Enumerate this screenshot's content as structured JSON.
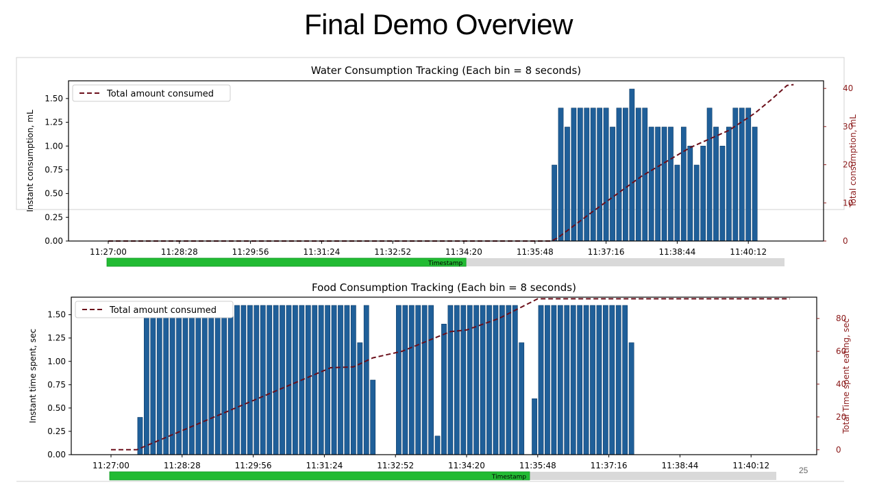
{
  "slide": {
    "title": "Final Demo Overview",
    "page_number": "25"
  },
  "colors": {
    "bar": "#1f5f99",
    "bar_edge": "#0d3b66",
    "total_line": "#6b0f1a",
    "right_axis": "#8b1a1a",
    "scroll_thumb": "#22bb33",
    "scroll_track": "#d9d9d9"
  },
  "chart_data": [
    {
      "type": "bar",
      "title": "Water Consumption Tracking (Each bin = 8 seconds)",
      "xlabel": "Timestamp",
      "ylabel": "Instant consumption, mL",
      "ylabel_right": "Total consumption, mL",
      "x_ticks": [
        "11:27:00",
        "11:28:28",
        "11:29:56",
        "11:31:24",
        "11:32:52",
        "11:34:20",
        "11:35:48",
        "11:37:16",
        "11:38:44",
        "11:40:12"
      ],
      "ylim": [
        0,
        1.6
      ],
      "yticks": [
        "0.00",
        "0.25",
        "0.50",
        "0.75",
        "1.00",
        "1.25",
        "1.50"
      ],
      "ylim_right": [
        0,
        42
      ],
      "yticks_right": [
        "0",
        "10",
        "20",
        "30",
        "40"
      ],
      "bin_seconds": 8,
      "legend": {
        "entry": "Total amount consumed",
        "placement": "top-left"
      },
      "series": [
        {
          "name": "Instant consumption",
          "start": "11:36:08",
          "values": [
            0.8,
            1.4,
            1.2,
            1.4,
            1.4,
            1.4,
            1.4,
            1.4,
            1.4,
            1.2,
            1.4,
            1.4,
            1.6,
            1.4,
            1.4,
            1.2,
            1.2,
            1.2,
            1.2,
            0.8,
            1.2,
            1.0,
            0.8,
            1.0,
            1.4,
            1.2,
            1.0,
            1.2,
            1.4,
            1.4,
            1.4,
            1.2
          ]
        },
        {
          "name": "Total amount consumed",
          "points": [
            [
              "11:27:00",
              0
            ],
            [
              "11:36:08",
              0
            ],
            [
              "11:36:16",
              0.8
            ],
            [
              "11:37:00",
              7.8
            ],
            [
              "11:38:00",
              17
            ],
            [
              "11:39:00",
              24.5
            ],
            [
              "11:39:48",
              29
            ],
            [
              "11:40:20",
              33.5
            ],
            [
              "11:40:40",
              37
            ],
            [
              "11:41:00",
              40.8
            ],
            [
              "11:41:08",
              41
            ]
          ]
        }
      ],
      "scrollbar": {
        "visible_fraction": 0.53
      }
    },
    {
      "type": "bar",
      "title": "Food Consumption Tracking (Each bin = 8 seconds)",
      "xlabel": "Timestamp",
      "ylabel": "Instant time spent, sec",
      "ylabel_right": "Total Time spent eating, sec",
      "x_ticks": [
        "11:27:00",
        "11:28:28",
        "11:29:56",
        "11:31:24",
        "11:32:52",
        "11:34:20",
        "11:35:48",
        "11:37:16",
        "11:38:44",
        "11:40:12"
      ],
      "ylim": [
        0,
        1.6
      ],
      "yticks": [
        "0.00",
        "0.25",
        "0.50",
        "0.75",
        "1.00",
        "1.25",
        "1.50"
      ],
      "ylim_right": [
        -3,
        93
      ],
      "yticks_right": [
        "0",
        "20",
        "40",
        "60",
        "80"
      ],
      "bin_seconds": 8,
      "legend": {
        "entry": "Total amount consumed",
        "placement": "top-left"
      },
      "series": [
        {
          "name": "Instant time spent",
          "start": "11:27:32",
          "values": [
            0.4,
            1.6,
            1.6,
            1.6,
            1.6,
            1.6,
            1.6,
            1.6,
            1.6,
            1.6,
            1.6,
            1.6,
            1.6,
            1.6,
            1.6,
            1.6,
            1.6,
            1.6,
            1.6,
            1.6,
            1.6,
            1.6,
            1.6,
            1.6,
            1.6,
            1.6,
            1.6,
            1.6,
            1.6,
            1.6,
            1.6,
            1.6,
            1.6,
            1.6,
            1.2,
            1.6,
            0.8,
            0,
            0,
            0,
            1.6,
            1.6,
            1.6,
            1.6,
            1.6,
            1.6,
            0.2,
            1.4,
            1.6,
            1.6,
            1.6,
            1.6,
            1.6,
            1.6,
            1.6,
            1.6,
            1.6,
            1.6,
            1.6,
            1.2,
            0,
            0.6,
            1.6,
            1.6,
            1.6,
            1.6,
            1.6,
            1.6,
            1.6,
            1.6,
            1.6,
            1.6,
            1.6,
            1.6,
            1.6,
            1.6,
            1.2
          ]
        },
        {
          "name": "Total amount consumed",
          "points": [
            [
              "11:27:00",
              0
            ],
            [
              "11:27:32",
              0
            ],
            [
              "11:31:32",
              50
            ],
            [
              "11:32:00",
              50.5
            ],
            [
              "11:32:24",
              56
            ],
            [
              "11:33:00",
              60
            ],
            [
              "11:34:00",
              72
            ],
            [
              "11:34:20",
              73
            ],
            [
              "11:35:00",
              80
            ],
            [
              "11:35:40",
              90
            ],
            [
              "11:35:48",
              92
            ],
            [
              "11:41:00",
              92
            ]
          ]
        }
      ],
      "scrollbar": {
        "visible_fraction": 0.63
      }
    }
  ]
}
